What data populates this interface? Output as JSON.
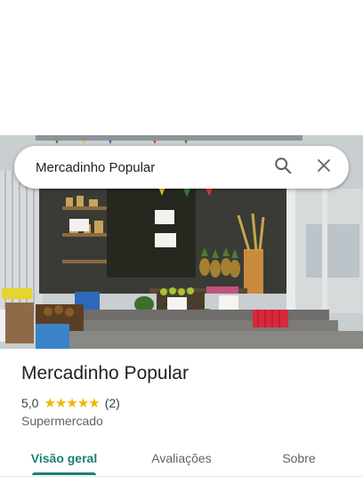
{
  "search": {
    "query": "Mercadinho Popular",
    "search_icon": "search-icon",
    "close_icon": "close-icon"
  },
  "place": {
    "name": "Mercadinho Popular",
    "rating": "5,0",
    "rating_value": 5,
    "review_count": "(2)",
    "category": "Supermercado"
  },
  "tabs": [
    {
      "label": "Visão geral",
      "active": true
    },
    {
      "label": "Avaliações",
      "active": false
    },
    {
      "label": "Sobre",
      "active": false
    }
  ],
  "colors": {
    "accent": "#1a7f78",
    "star": "#f4b400",
    "text": "#202124",
    "secondary_text": "#5f6368"
  }
}
